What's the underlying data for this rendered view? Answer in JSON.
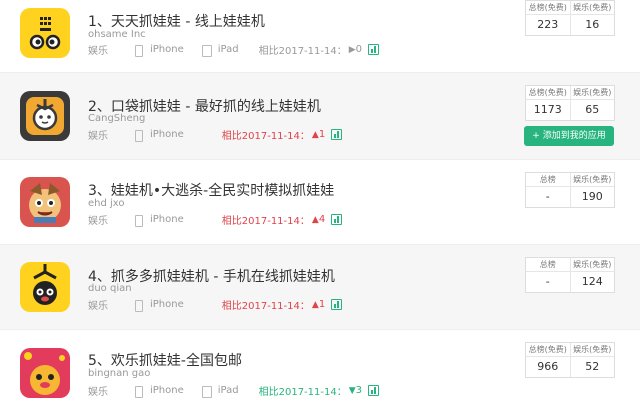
{
  "apps": [
    {
      "title": "1、天天抓娃娃 - 线上娃娃机",
      "developer": "ohsame Inc",
      "category": "娱乐",
      "platforms": [
        "iPhone",
        "iPad"
      ],
      "compare_text": "相比2017-11-14：",
      "change_arrow": "▶",
      "change_value": "0",
      "change_color": "grey",
      "icon_name": "yellow-face-app-icon",
      "rank_total_label": "总榜(免费)",
      "rank_category_label": "娱乐(免费)",
      "rank_total": "223",
      "rank_category": "16"
    },
    {
      "title": "2、口袋抓娃娃 - 最好抓的线上娃娃机",
      "developer": "CangSheng",
      "category": "娱乐",
      "platforms": [
        "iPhone"
      ],
      "compare_text": "相比2017-11-14：",
      "change_arrow": "▲",
      "change_value": "1",
      "change_color": "red",
      "icon_name": "claw-bear-app-icon",
      "rank_total_label": "总榜(免费)",
      "rank_category_label": "娱乐(免费)",
      "rank_total": "1173",
      "rank_category": "65",
      "add_button_label": "+ 添加到我的应用"
    },
    {
      "title": "3、娃娃机•大逃杀-全民实时模拟抓娃娃",
      "developer": "ehd jxo",
      "category": "娱乐",
      "platforms": [
        "iPhone"
      ],
      "compare_text": "相比2017-11-14：",
      "change_arrow": "▲",
      "change_value": "4",
      "change_color": "red",
      "icon_name": "cartoon-character-app-icon",
      "rank_total_label": "总榜",
      "rank_category_label": "娱乐(免费)",
      "rank_total": "-",
      "rank_category": "190"
    },
    {
      "title": "4、抓多多抓娃娃机 - 手机在线抓娃娃机",
      "developer": "duo qian",
      "category": "娱乐",
      "platforms": [
        "iPhone"
      ],
      "compare_text": "相比2017-11-14：",
      "change_arrow": "▲",
      "change_value": "1",
      "change_color": "red",
      "icon_name": "claw-panda-app-icon",
      "rank_total_label": "总榜",
      "rank_category_label": "娱乐(免费)",
      "rank_total": "-",
      "rank_category": "124"
    },
    {
      "title": "5、欢乐抓娃娃-全国包邮",
      "developer": "bingnan gao",
      "category": "娱乐",
      "platforms": [
        "iPhone",
        "iPad"
      ],
      "compare_text": "相比2017-11-14：",
      "change_arrow": "▼",
      "change_value": "3",
      "change_color": "green",
      "icon_name": "red-pig-app-icon",
      "rank_total_label": "总榜(免费)",
      "rank_category_label": "娱乐(免费)",
      "rank_total": "966",
      "rank_category": "52"
    }
  ]
}
